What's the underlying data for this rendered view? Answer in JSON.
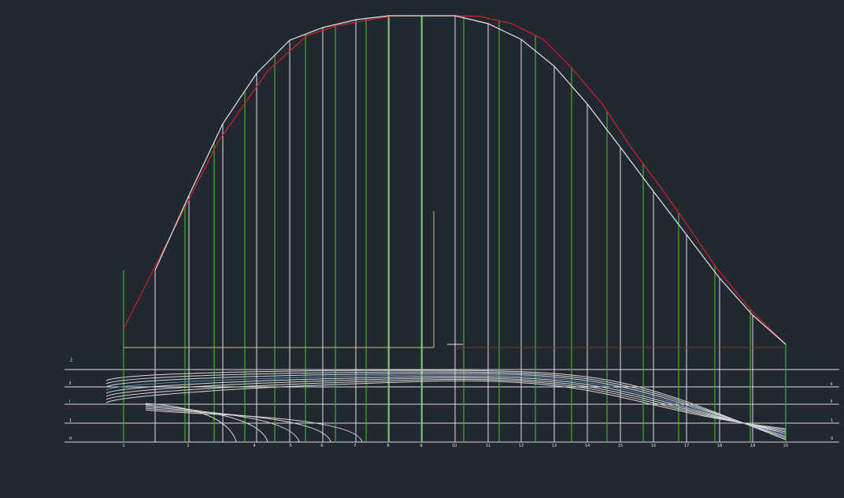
{
  "drawing": {
    "colors": {
      "background": "#212830",
      "curve": "#e6e6e6",
      "design_curve": "#d0202a",
      "station_green": "#3fae2c",
      "baseline": "#c8c08a",
      "waterline_blue": "#5b8fc4"
    },
    "bottom_station_labels": [
      "1",
      "2",
      "4",
      "5",
      "6",
      "7",
      "8",
      "9",
      "10",
      "11",
      "12",
      "13",
      "14",
      "15",
      "16",
      "17",
      "18",
      "19",
      "20"
    ],
    "waterline_labels_left": [
      "上",
      "Ⅱ",
      "Ⅰ",
      "1",
      "0"
    ],
    "waterline_labels_right": [
      "Ⅱ",
      "Ⅱ",
      "1",
      "0"
    ]
  }
}
